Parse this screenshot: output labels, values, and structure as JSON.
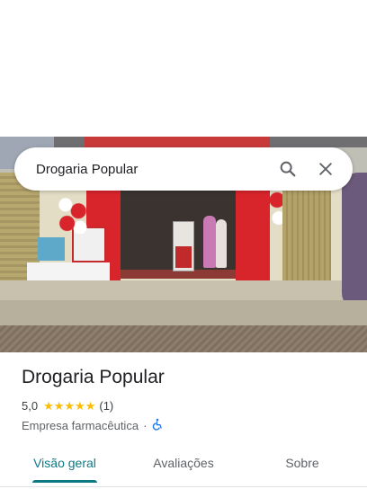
{
  "search": {
    "query": "Drogaria Popular",
    "search_icon": "search-icon",
    "close_icon": "close-icon"
  },
  "place": {
    "name": "Drogaria Popular",
    "rating": "5,0",
    "stars": 5,
    "review_count": "(1)",
    "category": "Empresa farmacêutica",
    "separator": "·",
    "accessibility_icon": "wheelchair-icon"
  },
  "tabs": [
    {
      "label": "Visão geral",
      "active": true
    },
    {
      "label": "Avaliações",
      "active": false
    },
    {
      "label": "Sobre",
      "active": false
    }
  ],
  "colors": {
    "accent": "#0b7a86",
    "star": "#fbbc04",
    "accessibility": "#1a73e8"
  }
}
